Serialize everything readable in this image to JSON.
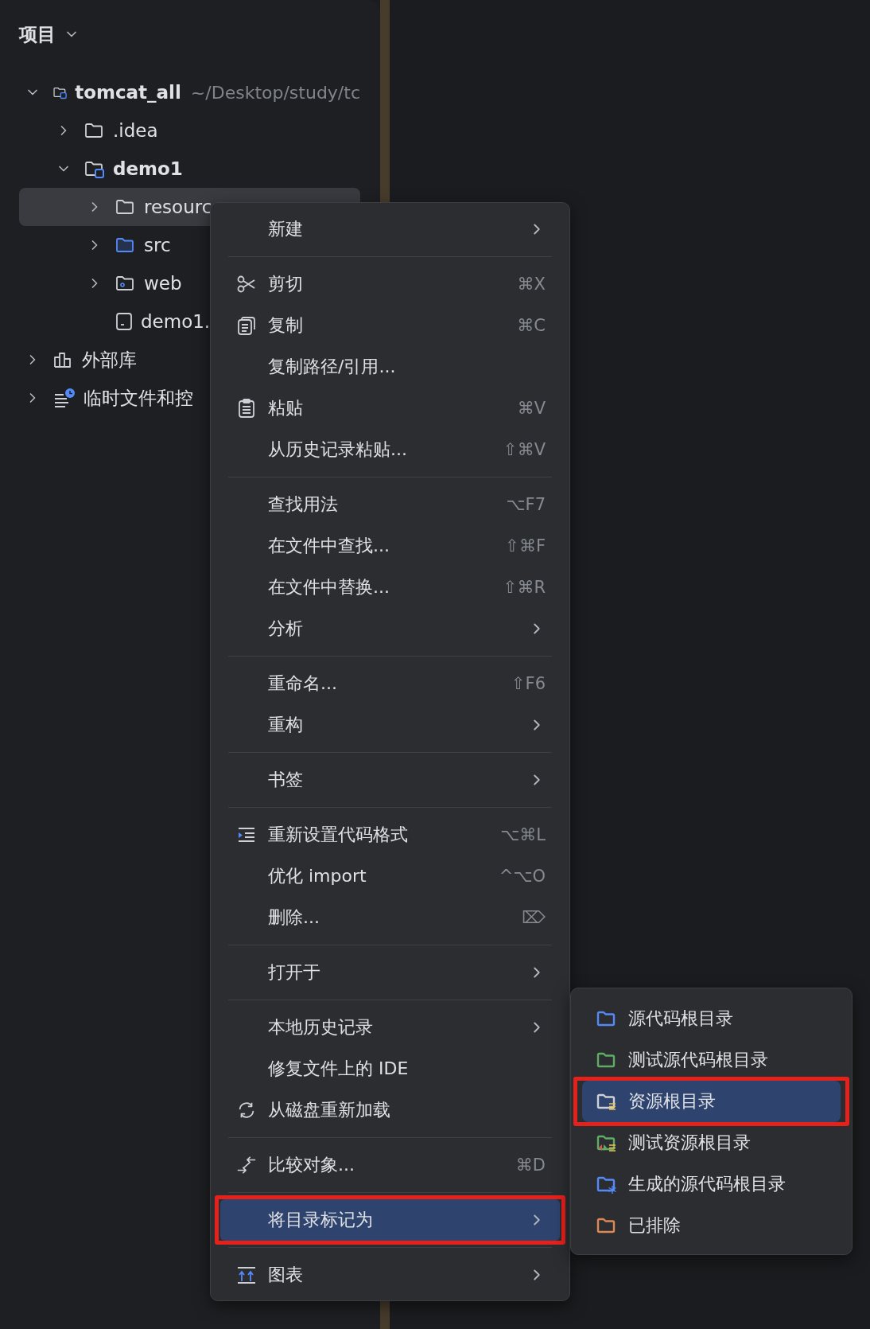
{
  "panel": {
    "title": "项目"
  },
  "tree": [
    {
      "name": "tomcat_all",
      "detail": "~/Desktop/study/tc",
      "bold": true,
      "kind": "module",
      "expanded": true,
      "selected": false,
      "children": [
        {
          "name": ".idea",
          "bold": false,
          "kind": "folder",
          "expanded": false,
          "selected": false
        },
        {
          "name": "demo1",
          "bold": true,
          "kind": "module",
          "expanded": true,
          "selected": false,
          "children": [
            {
              "name": "resourc",
              "bold": false,
              "kind": "folder",
              "expanded": false,
              "selected": true
            },
            {
              "name": "src",
              "bold": false,
              "kind": "source",
              "expanded": false,
              "selected": false
            },
            {
              "name": "web",
              "bold": false,
              "kind": "web",
              "expanded": false,
              "selected": false
            },
            {
              "name": "demo1.",
              "bold": false,
              "kind": "file",
              "selected": false
            }
          ]
        }
      ]
    },
    {
      "name": "外部库",
      "bold": false,
      "kind": "library",
      "expanded": false,
      "selected": false
    },
    {
      "name": "临时文件和控",
      "bold": false,
      "kind": "scratch",
      "expanded": false,
      "selected": false
    }
  ],
  "context_menu": {
    "groups": [
      [
        {
          "label": "新建",
          "submenu": true,
          "selected": false,
          "marked": false
        }
      ],
      [
        {
          "label": "剪切",
          "kind": "scissors",
          "shortcut": "⌘X",
          "selected": false,
          "marked": false
        },
        {
          "label": "复制",
          "kind": "copy",
          "shortcut": "⌘C",
          "selected": false,
          "marked": false
        },
        {
          "label": "复制路径/引用...",
          "selected": false,
          "marked": false
        },
        {
          "label": "粘贴",
          "kind": "paste",
          "shortcut": "⌘V",
          "selected": false,
          "marked": false
        },
        {
          "label": "从历史记录粘贴...",
          "shortcut": "⇧⌘V",
          "selected": false,
          "marked": false
        }
      ],
      [
        {
          "label": "查找用法",
          "shortcut": "⌥F7",
          "selected": false,
          "marked": false
        },
        {
          "label": "在文件中查找...",
          "shortcut": "⇧⌘F",
          "selected": false,
          "marked": false
        },
        {
          "label": "在文件中替换...",
          "shortcut": "⇧⌘R",
          "selected": false,
          "marked": false
        },
        {
          "label": "分析",
          "submenu": true,
          "selected": false,
          "marked": false
        }
      ],
      [
        {
          "label": "重命名...",
          "shortcut": "⇧F6",
          "selected": false,
          "marked": false
        },
        {
          "label": "重构",
          "submenu": true,
          "selected": false,
          "marked": false
        }
      ],
      [
        {
          "label": "书签",
          "submenu": true,
          "selected": false,
          "marked": false
        }
      ],
      [
        {
          "label": "重新设置代码格式",
          "kind": "reformat",
          "shortcut": "⌥⌘L",
          "selected": false,
          "marked": false
        },
        {
          "label": "优化 import",
          "shortcut": "^⌥O",
          "selected": false,
          "marked": false
        },
        {
          "label": "删除...",
          "shortcut": "⌦",
          "selected": false,
          "marked": false
        }
      ],
      [
        {
          "label": "打开于",
          "submenu": true,
          "selected": false,
          "marked": false
        }
      ],
      [
        {
          "label": "本地历史记录",
          "submenu": true,
          "selected": false,
          "marked": false
        },
        {
          "label": "修复文件上的 IDE",
          "selected": false,
          "marked": false
        },
        {
          "label": "从磁盘重新加载",
          "kind": "reload",
          "selected": false,
          "marked": false
        }
      ],
      [
        {
          "label": "比较对象...",
          "kind": "compare",
          "shortcut": "⌘D",
          "selected": false,
          "marked": false
        }
      ],
      [
        {
          "label": "将目录标记为",
          "submenu": true,
          "selected": true,
          "marked": true
        }
      ],
      [
        {
          "label": "图表",
          "kind": "diagram",
          "submenu": true,
          "selected": false,
          "marked": false
        }
      ]
    ]
  },
  "submenu": {
    "items": [
      {
        "label": "源代码根目录",
        "kind": "source",
        "color": "#548af7",
        "selected": false,
        "marked": false
      },
      {
        "label": "测试源代码根目录",
        "kind": "test",
        "color": "#5fad65",
        "selected": false,
        "marked": false
      },
      {
        "label": "资源根目录",
        "kind": "resource",
        "color": "#ced0d6",
        "selected": true,
        "marked": true
      },
      {
        "label": "测试资源根目录",
        "kind": "test_resource",
        "color": "#5fad65",
        "selected": false,
        "marked": false
      },
      {
        "label": "生成的源代码根目录",
        "kind": "generated",
        "color": "#548af7",
        "selected": false,
        "marked": false
      },
      {
        "label": "已排除",
        "kind": "excluded",
        "color": "#e08855",
        "selected": false,
        "marked": false
      }
    ]
  }
}
